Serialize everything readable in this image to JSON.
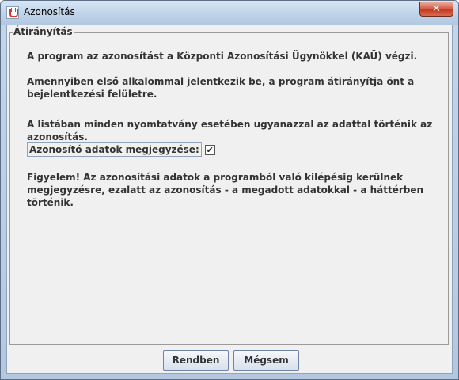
{
  "window": {
    "title": "Azonosítás",
    "close_label": "✕"
  },
  "section": {
    "legend": "Átirányítás",
    "paragraphs": [
      "A program az azonosítást a Központi Azonosítási Ügynökkel (KAÜ) végzi.",
      "Amennyiben első alkalommal jelentkezik be, a program átirányítja önt a bejelentkezési felületre.",
      "A listában minden nyomtatvány esetében ugyanazzal az adattal történik az azonosítás.",
      "Figyelem! Az azonosítási adatok a programból való kilépésig kerülnek megjegyzésre, ezalatt az azonosítás - a megadott adatokkal - a háttérben történik."
    ],
    "remember_label": "Azonosító adatok megjegyzése:",
    "remember_checked": true,
    "check_mark": "✔"
  },
  "buttons": {
    "ok_label": "Rendben",
    "cancel_label": "Mégsem"
  }
}
